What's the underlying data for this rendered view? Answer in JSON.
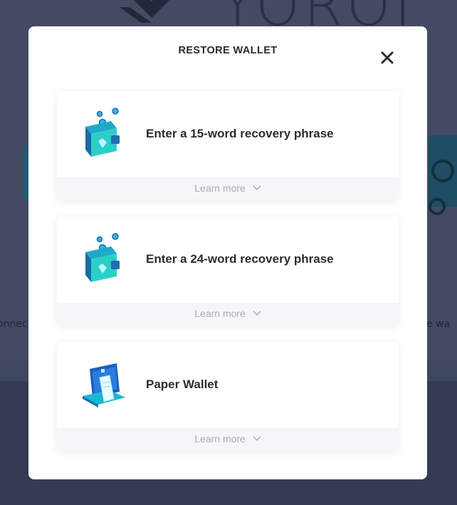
{
  "background": {
    "logo_text": "YOROI",
    "left_fragment": "onnec",
    "right_fragment": "ore wa"
  },
  "modal": {
    "title": "RESTORE WALLET",
    "close_icon": "close-icon",
    "options": [
      {
        "label": "Enter a 15-word recovery phrase",
        "icon": "wallet-coins-icon",
        "learn_more": "Learn more"
      },
      {
        "label": "Enter a 24-word recovery phrase",
        "icon": "wallet-coins-icon",
        "learn_more": "Learn more"
      },
      {
        "label": "Paper Wallet",
        "icon": "paper-wallet-icon",
        "learn_more": "Learn more"
      }
    ]
  },
  "colors": {
    "overlay": "#3f465f",
    "modal_bg": "#ffffff",
    "text": "#2b2c32",
    "muted": "#a8adb9",
    "accent": "#17d1aa"
  }
}
